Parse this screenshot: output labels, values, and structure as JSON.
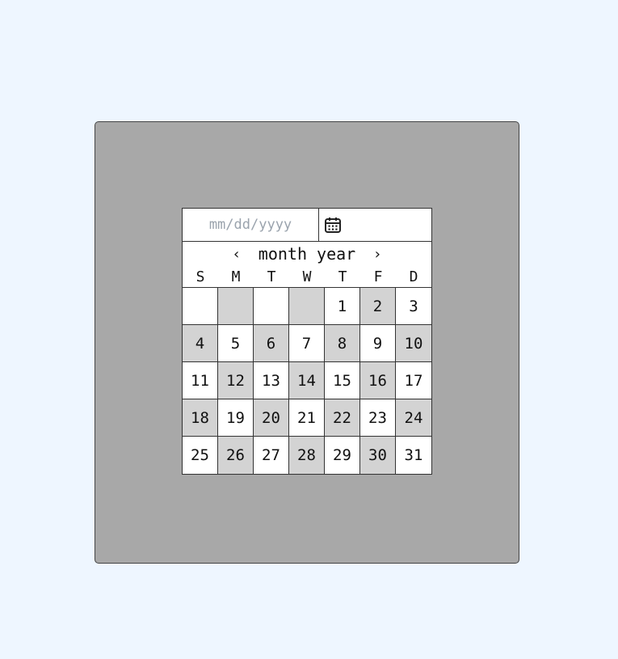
{
  "date_input": {
    "placeholder": "mm/dd/yyyy",
    "value": ""
  },
  "calendar_icon": "calendar-icon",
  "calendar": {
    "prev_label": "‹",
    "month_year_label": "month year",
    "next_label": "›",
    "weekdays": [
      "S",
      "M",
      "T",
      "W",
      "T",
      "F",
      "D"
    ],
    "days": [
      "",
      "",
      "",
      "",
      "1",
      "2",
      "3",
      "4",
      "5",
      "6",
      "7",
      "8",
      "9",
      "10",
      "11",
      "12",
      "13",
      "14",
      "15",
      "16",
      "17",
      "18",
      "19",
      "20",
      "21",
      "22",
      "23",
      "24",
      "25",
      "26",
      "27",
      "28",
      "29",
      "30",
      "31"
    ]
  },
  "colors": {
    "page_background": "#eef6ff",
    "panel_background": "#a8a8a8",
    "cell_shaded": "#d3d3d3",
    "cell_plain": "#ffffff"
  }
}
